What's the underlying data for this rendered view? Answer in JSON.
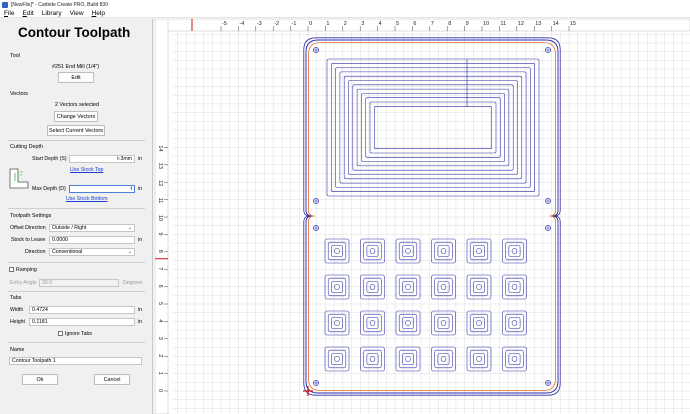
{
  "window": {
    "title": "[NewFile]* - Carbide Create PRO, Build 830"
  },
  "menu": [
    {
      "mnemonic": "F",
      "rest": "ile"
    },
    {
      "mnemonic": "E",
      "rest": "dit"
    },
    {
      "mnemonic": "",
      "rest": "Library"
    },
    {
      "mnemonic": "",
      "rest": "View"
    },
    {
      "mnemonic": "H",
      "rest": "elp"
    }
  ],
  "panel": {
    "title": "Contour Toolpath",
    "tool": {
      "heading": "Tool",
      "name": "#251 End Mill (1/4\")",
      "edit_label": "Edit"
    },
    "vectors": {
      "heading": "Vectors",
      "status": "2 Vectors selected",
      "change_label": "Change Vectors",
      "select_label": "Select Current Vectors"
    },
    "cutting_depth": {
      "heading": "Cutting Depth",
      "start_label": "Start Depth (S)",
      "start_value": "t-3mm",
      "start_unit": "in",
      "use_top": "Use Stock Top",
      "max_label": "Max Depth (D)",
      "max_value": "t",
      "max_unit": "in",
      "use_bottom": "Use Stock Bottom"
    },
    "settings": {
      "heading": "Toolpath Settings",
      "offset_label": "Offset Direction",
      "offset_value": "Outside / Right",
      "stock_label": "Stock to Leave",
      "stock_value": "0.0000",
      "stock_unit": "in",
      "direction_label": "Direction",
      "direction_value": "Conventional"
    },
    "ramping": {
      "label": "Ramping",
      "angle_label": "Entry Angle",
      "angle_value": "20.0",
      "angle_unit": "Degrees"
    },
    "tabs": {
      "heading": "Tabs",
      "width_label": "Width",
      "width_value": "0.4724",
      "width_unit": "in",
      "height_label": "Height",
      "height_value": "0.1181",
      "height_unit": "in",
      "ignore_label": "Ignore Tabs"
    },
    "name": {
      "heading": "Name",
      "value": "Contour Toolpath",
      "cursor": "1"
    },
    "ok_label": "Ok",
    "cancel_label": "Cancel"
  },
  "canvas": {
    "x_ticks": [
      "-5",
      "-4",
      "-3",
      "-2",
      "-1",
      "0",
      "1",
      "2",
      "3",
      "4",
      "5",
      "6",
      "7",
      "8",
      "9",
      "10",
      "11",
      "12",
      "13",
      "14",
      "15"
    ],
    "y_ticks": [
      "14",
      "13",
      "12",
      "11",
      "10",
      "9",
      "8",
      "7",
      "6",
      "5",
      "4",
      "3",
      "2",
      "1",
      "0"
    ],
    "colors": {
      "vector": "#2a2aa8",
      "toolpath": "#e8702a",
      "grid": "#d6d6d6",
      "origin": "#cc1111"
    }
  }
}
